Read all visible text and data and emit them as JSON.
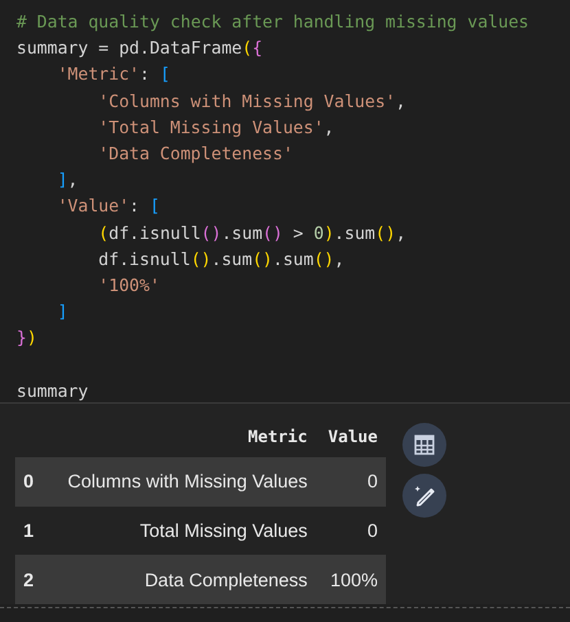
{
  "code_cell": {
    "lines": [
      {
        "kind": "top",
        "tokens": [
          {
            "kind": "comment",
            "text": "# Data quality check after handling missing values"
          }
        ]
      },
      {
        "kind": "top",
        "tokens": [
          {
            "kind": "plain",
            "text": "summary = pd.DataFrame"
          },
          {
            "kind": "bracket1",
            "text": "("
          },
          {
            "kind": "bracket2",
            "text": "{"
          }
        ]
      },
      {
        "kind": "nested",
        "tokens": [
          {
            "kind": "string",
            "text": "'Metric'"
          },
          {
            "kind": "plain",
            "text": ": "
          },
          {
            "kind": "bracket3",
            "text": "["
          }
        ]
      },
      {
        "kind": "deep",
        "tokens": [
          {
            "kind": "string",
            "text": "'Columns with Missing Values'"
          },
          {
            "kind": "plain",
            "text": ","
          }
        ]
      },
      {
        "kind": "deep",
        "tokens": [
          {
            "kind": "string",
            "text": "'Total Missing Values'"
          },
          {
            "kind": "plain",
            "text": ","
          }
        ]
      },
      {
        "kind": "deep",
        "tokens": [
          {
            "kind": "string",
            "text": "'Data Completeness'"
          }
        ]
      },
      {
        "kind": "nested",
        "tokens": [
          {
            "kind": "bracket3",
            "text": "]"
          },
          {
            "kind": "plain",
            "text": ","
          }
        ]
      },
      {
        "kind": "nested",
        "tokens": [
          {
            "kind": "string",
            "text": "'Value'"
          },
          {
            "kind": "plain",
            "text": ": "
          },
          {
            "kind": "bracket3",
            "text": "["
          }
        ]
      },
      {
        "kind": "deep",
        "tokens": [
          {
            "kind": "bracket1",
            "text": "("
          },
          {
            "kind": "plain",
            "text": "df.isnull"
          },
          {
            "kind": "bracket2",
            "text": "()"
          },
          {
            "kind": "plain",
            "text": ".sum"
          },
          {
            "kind": "bracket2",
            "text": "()"
          },
          {
            "kind": "plain",
            "text": " > "
          },
          {
            "kind": "number",
            "text": "0"
          },
          {
            "kind": "bracket1",
            "text": ")"
          },
          {
            "kind": "plain",
            "text": ".sum"
          },
          {
            "kind": "bracket1",
            "text": "()"
          },
          {
            "kind": "plain",
            "text": ","
          }
        ]
      },
      {
        "kind": "deep",
        "tokens": [
          {
            "kind": "plain",
            "text": "df.isnull"
          },
          {
            "kind": "bracket1",
            "text": "()"
          },
          {
            "kind": "plain",
            "text": ".sum"
          },
          {
            "kind": "bracket1",
            "text": "()"
          },
          {
            "kind": "plain",
            "text": ".sum"
          },
          {
            "kind": "bracket1",
            "text": "()"
          },
          {
            "kind": "plain",
            "text": ","
          }
        ]
      },
      {
        "kind": "deep",
        "tokens": [
          {
            "kind": "string",
            "text": "'100%'"
          }
        ]
      },
      {
        "kind": "nested",
        "tokens": [
          {
            "kind": "bracket3",
            "text": "]"
          }
        ]
      },
      {
        "kind": "top",
        "tokens": [
          {
            "kind": "bracket2",
            "text": "}"
          },
          {
            "kind": "bracket1",
            "text": ")"
          }
        ]
      },
      {
        "kind": "blank"
      },
      {
        "kind": "top",
        "tokens": [
          {
            "kind": "plain",
            "text": "summary"
          }
        ]
      }
    ]
  },
  "output_table": {
    "columns": [
      "Metric",
      "Value"
    ],
    "rows": [
      {
        "index": "0",
        "metric": "Columns with Missing Values",
        "value": "0"
      },
      {
        "index": "1",
        "metric": "Total Missing Values",
        "value": "0"
      },
      {
        "index": "2",
        "metric": "Data Completeness",
        "value": "100%"
      }
    ]
  }
}
